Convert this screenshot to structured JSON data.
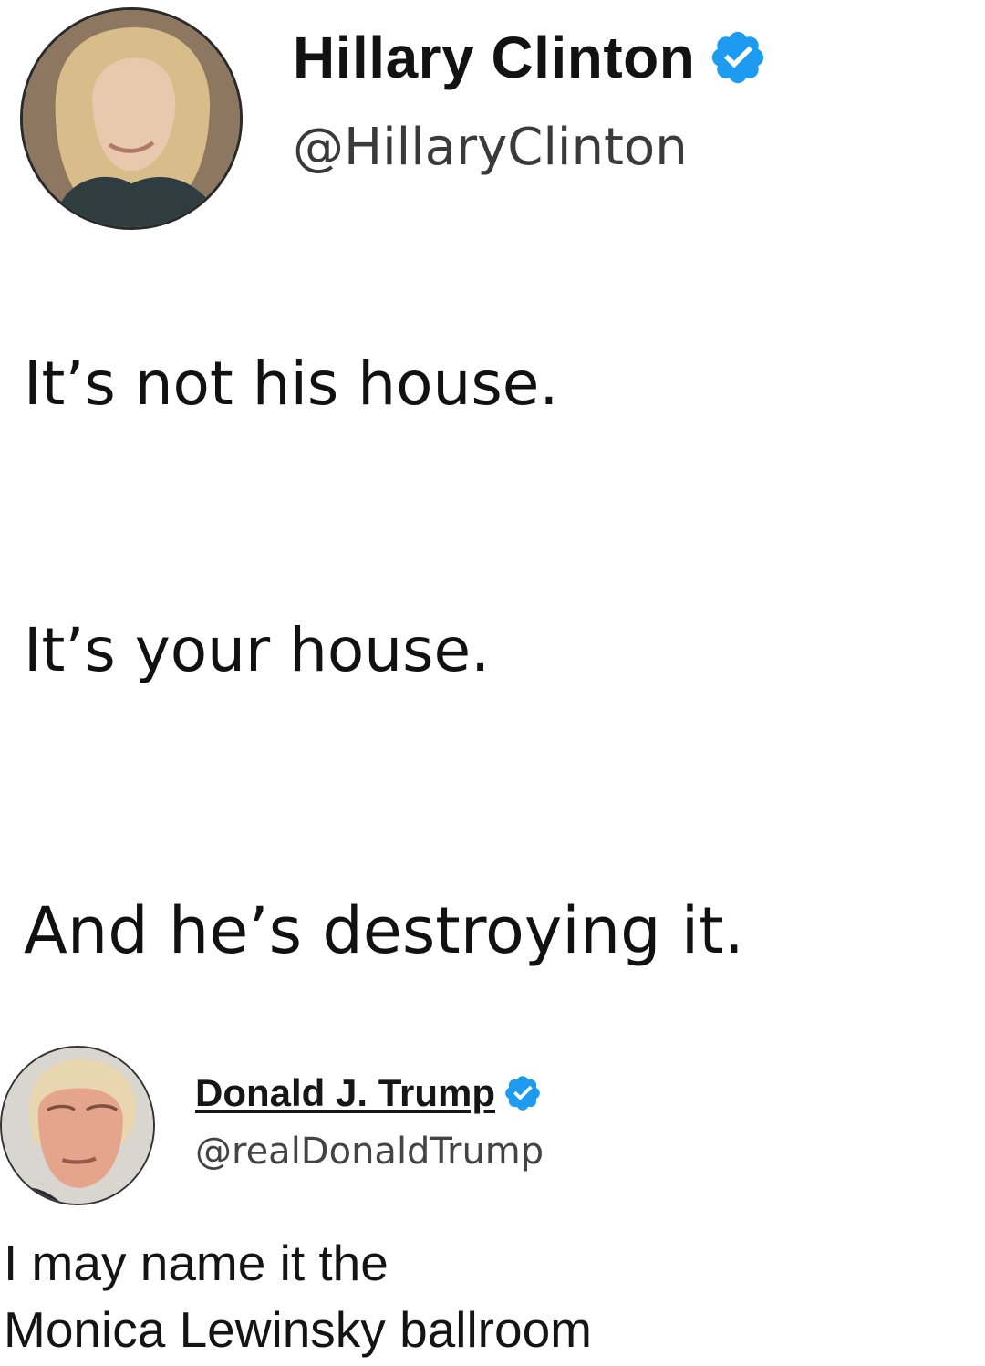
{
  "tweet": {
    "author": {
      "display_name": "Hillary Clinton",
      "handle": "@HillaryClinton",
      "verified": true,
      "avatar_icon": "profile-photo-icon"
    },
    "lines": [
      "It’s not his house.",
      "It’s your house.",
      "And he’s destroying it."
    ]
  },
  "reply": {
    "author": {
      "display_name": "Donald J. Trump",
      "handle": "@realDonaldTrump",
      "verified": true,
      "avatar_icon": "profile-photo-icon"
    },
    "lines": [
      "I may name it the",
      "Monica Lewinsky ballroom"
    ]
  },
  "colors": {
    "verified_badge": "#1d9bf0",
    "text": "#111111",
    "handle": "#3a3a3a",
    "background": "#ffffff"
  }
}
